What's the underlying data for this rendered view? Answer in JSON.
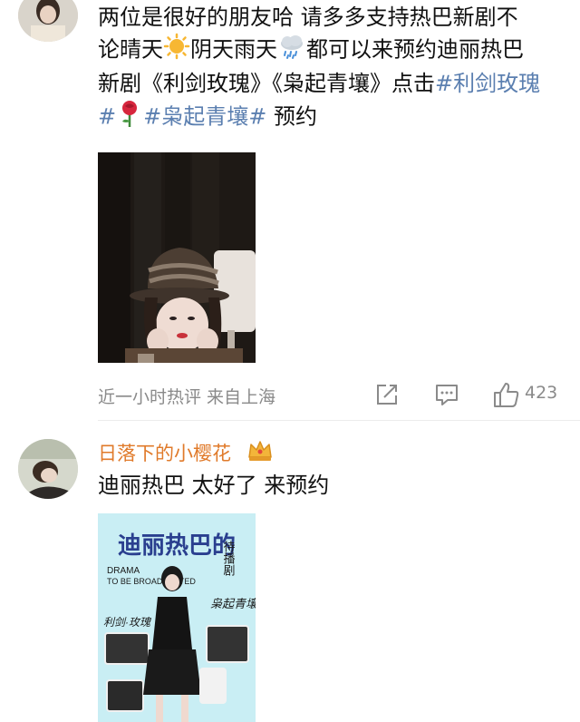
{
  "comment1": {
    "line1": "两位是很好的朋友哈 请多多支持热巴新剧不",
    "line2_a": "论晴天",
    "line2_b": "阴天雨天",
    "line2_c": "都可以来预约迪丽热巴",
    "line3_a": "新剧《利剑玫瑰》《枭起青壤》点击",
    "tag1": "#利剑玫瑰",
    "tag1_end": "#",
    "tag2": "#枭起青壤#",
    "line4_end": " 预约",
    "meta": "近一小时热评 来自上海",
    "like_count": "423",
    "emojis": [
      "sun-emoji",
      "rain-cloud-emoji",
      "rose-emoji"
    ]
  },
  "comment2": {
    "username": "日落下的小樱花",
    "text": "迪丽热巴 太好了 来预约",
    "badge_icon": "crown-icon"
  },
  "poster": {
    "title": "迪丽热巴的",
    "subtitle_en_1": "DRAMA",
    "subtitle_en_2": "TO BE BROADCASTED",
    "side_text": "待播剧",
    "drama1": "利剑·玫瑰",
    "drama2": "枭起青壤"
  },
  "colors": {
    "tag": "#5b7fb0",
    "username": "#e07a2a",
    "meta": "#8a8a8a"
  }
}
